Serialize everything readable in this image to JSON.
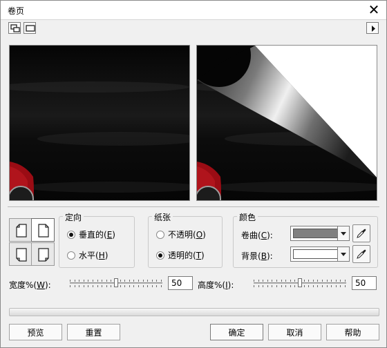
{
  "window": {
    "title": "卷页"
  },
  "orientation": {
    "title": "定向",
    "vertical": {
      "label": "垂直的",
      "key": "E",
      "selected": true
    },
    "horizontal": {
      "label": "水平",
      "key": "H",
      "selected": false
    }
  },
  "paper": {
    "title": "纸张",
    "opaque": {
      "label": "不透明",
      "key": "O",
      "selected": false
    },
    "transparent": {
      "label": "透明的",
      "key": "T",
      "selected": true
    }
  },
  "colors": {
    "title": "颜色",
    "curl": {
      "label": "卷曲",
      "key": "C",
      "value": "#808080"
    },
    "background": {
      "label": "背景",
      "key": "B",
      "value": "#ffffff"
    }
  },
  "width": {
    "label": "宽度%",
    "key": "W",
    "value": "50"
  },
  "height": {
    "label": "高度%",
    "key": "I",
    "value": "50"
  },
  "buttons": {
    "preview": "预览",
    "reset": "重置",
    "ok": "确定",
    "cancel": "取消",
    "help": "帮助"
  }
}
